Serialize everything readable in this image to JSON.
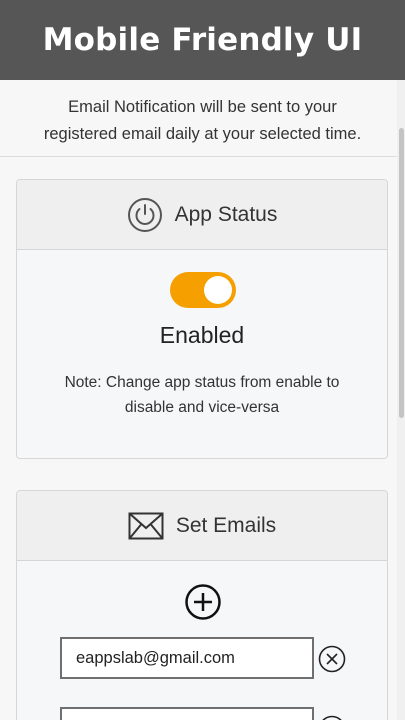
{
  "header": {
    "title": "Mobile Friendly UI"
  },
  "notice": {
    "line1": "Email Notification will be sent to your",
    "line2": "registered email daily at your selected time."
  },
  "app_status": {
    "title": "App Status",
    "icon": "power-icon",
    "toggle_on": true,
    "toggle_color": "#f5a000",
    "status_text": "Enabled",
    "note_line1": "Note: Change app status from enable to",
    "note_line2": "disable and vice-versa"
  },
  "set_emails": {
    "title": "Set Emails",
    "icon": "envelope-icon",
    "add_icon": "plus-circle-icon",
    "remove_icon": "close-circle-icon",
    "emails": [
      "eappslab@gmail.com",
      ""
    ]
  }
}
